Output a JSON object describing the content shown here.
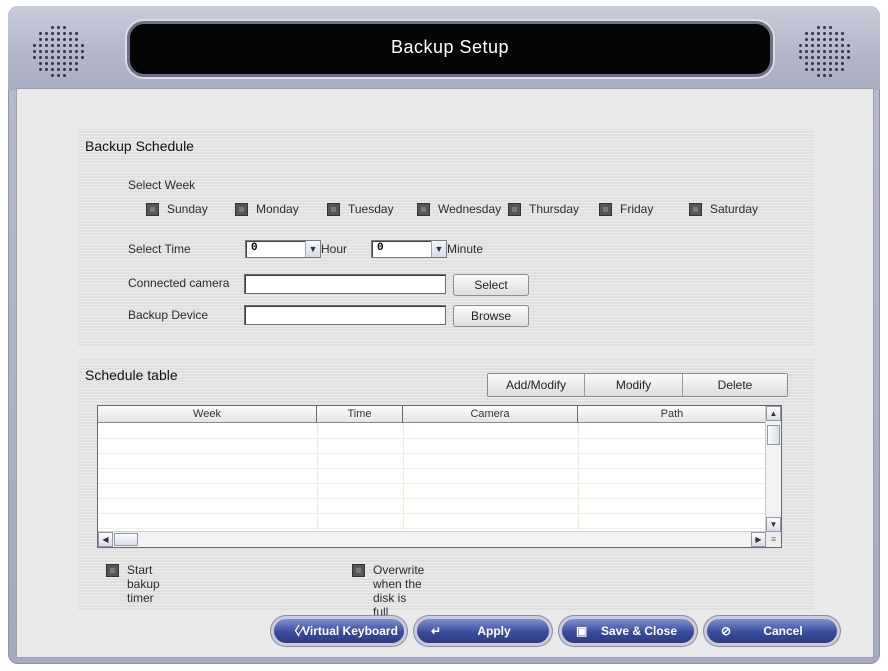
{
  "window": {
    "title": "Backup Setup"
  },
  "backup_schedule": {
    "title": "Backup Schedule",
    "select_week_label": "Select Week",
    "days": [
      "Sunday",
      "Monday",
      "Tuesday",
      "Wednesday",
      "Thursday",
      "Friday",
      "Saturday"
    ],
    "select_time_label": "Select Time",
    "hour_value": "0",
    "hour_label": "Hour",
    "minute_value": "0",
    "minute_label": "Minute",
    "connected_camera_label": "Connected camera",
    "connected_camera_value": "",
    "select_button": "Select",
    "backup_device_label": "Backup Device",
    "backup_device_value": "",
    "browse_button": "Browse"
  },
  "schedule_table": {
    "title": "Schedule table",
    "add_modify_button": "Add/Modify",
    "modify_button": "Modify",
    "delete_button": "Delete",
    "columns": [
      "Week",
      "Time",
      "Camera",
      "Path"
    ],
    "rows": []
  },
  "options": {
    "start_timer_label": "Start bakup timer",
    "overwrite_label": "Overwrite when the disk is full"
  },
  "footer": {
    "virtual_keyboard": "Virtual Keyboard",
    "apply": "Apply",
    "save_close": "Save & Close",
    "cancel": "Cancel"
  },
  "colors": {
    "title_bg": "#050505",
    "button_blue": "#3b4c9d",
    "frame": "#b3b6c8"
  },
  "icons": [
    "keyboard-icon",
    "enter-icon",
    "save-icon",
    "cancel-icon",
    "speaker-grille-icon"
  ]
}
